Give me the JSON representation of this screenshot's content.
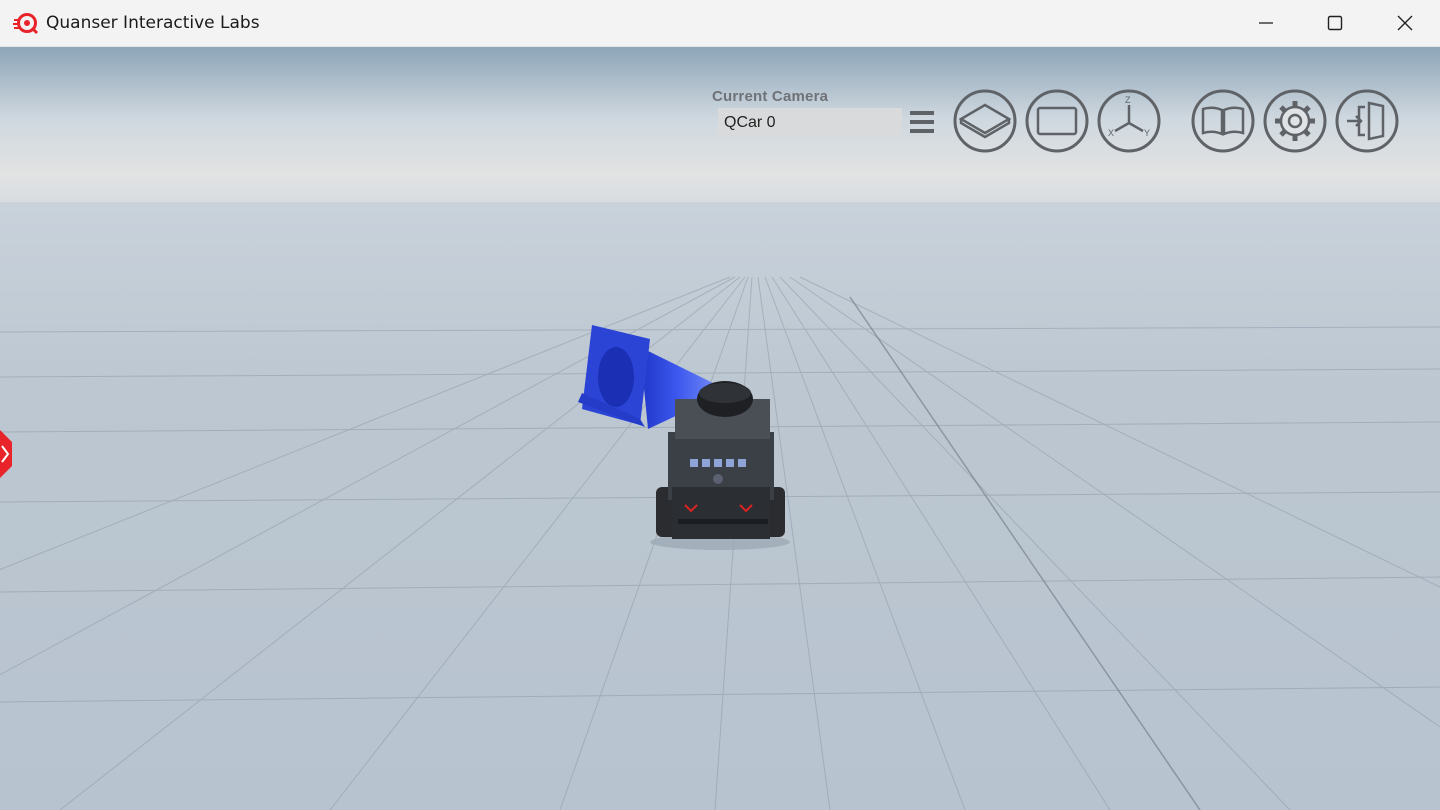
{
  "window": {
    "title": "Quanser Interactive Labs",
    "controls": [
      "minimize",
      "maximize",
      "close"
    ]
  },
  "hud": {
    "camera_label": "Current Camera",
    "camera_value": "QCar 0",
    "axis_icon_letters": {
      "z": "Z",
      "x": "X",
      "y": "Y"
    },
    "buttons": [
      "top-view-icon",
      "front-view-icon",
      "axis-view-icon",
      "manual-icon",
      "settings-icon",
      "exit-icon"
    ]
  },
  "scene": {
    "objects": [
      "traffic-cone",
      "qcar"
    ],
    "cone_color": "#2e47d8",
    "accent_color": "#e8242a"
  }
}
